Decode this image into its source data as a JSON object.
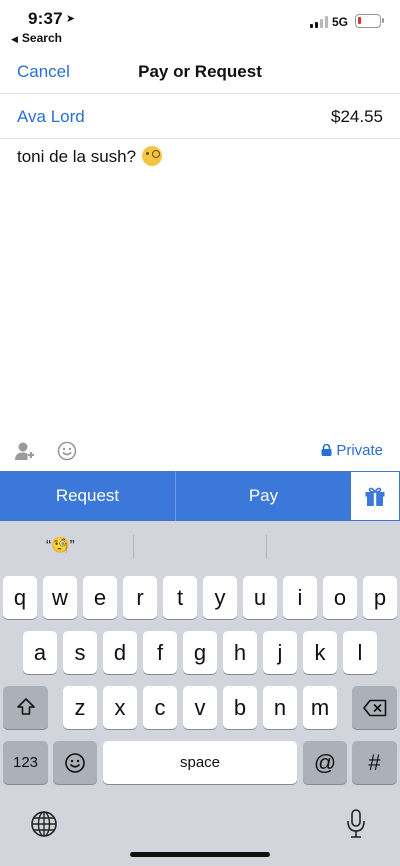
{
  "status_bar": {
    "time": "9:37",
    "location_glyph": "➤",
    "back_app_label": "Search",
    "network": "5G",
    "battery_color": "#e0312b"
  },
  "nav": {
    "cancel_label": "Cancel",
    "title": "Pay or Request"
  },
  "transaction": {
    "recipient": "Ava Lord",
    "amount": "$24.55",
    "note": "toni de la sush?",
    "note_emoji": "face-with-monocle"
  },
  "options": {
    "privacy_label": "Private"
  },
  "actions": {
    "request_label": "Request",
    "pay_label": "Pay",
    "accent_color": "#3b78da"
  },
  "keyboard": {
    "suggestions": [
      "“🧐”",
      "",
      ""
    ],
    "row1": [
      "q",
      "w",
      "e",
      "r",
      "t",
      "y",
      "u",
      "i",
      "o",
      "p"
    ],
    "row2": [
      "a",
      "s",
      "d",
      "f",
      "g",
      "h",
      "j",
      "k",
      "l"
    ],
    "row3": [
      "z",
      "x",
      "c",
      "v",
      "b",
      "n",
      "m"
    ],
    "numbers_label": "123",
    "space_label": "space",
    "at_label": "@",
    "hash_label": "#"
  }
}
